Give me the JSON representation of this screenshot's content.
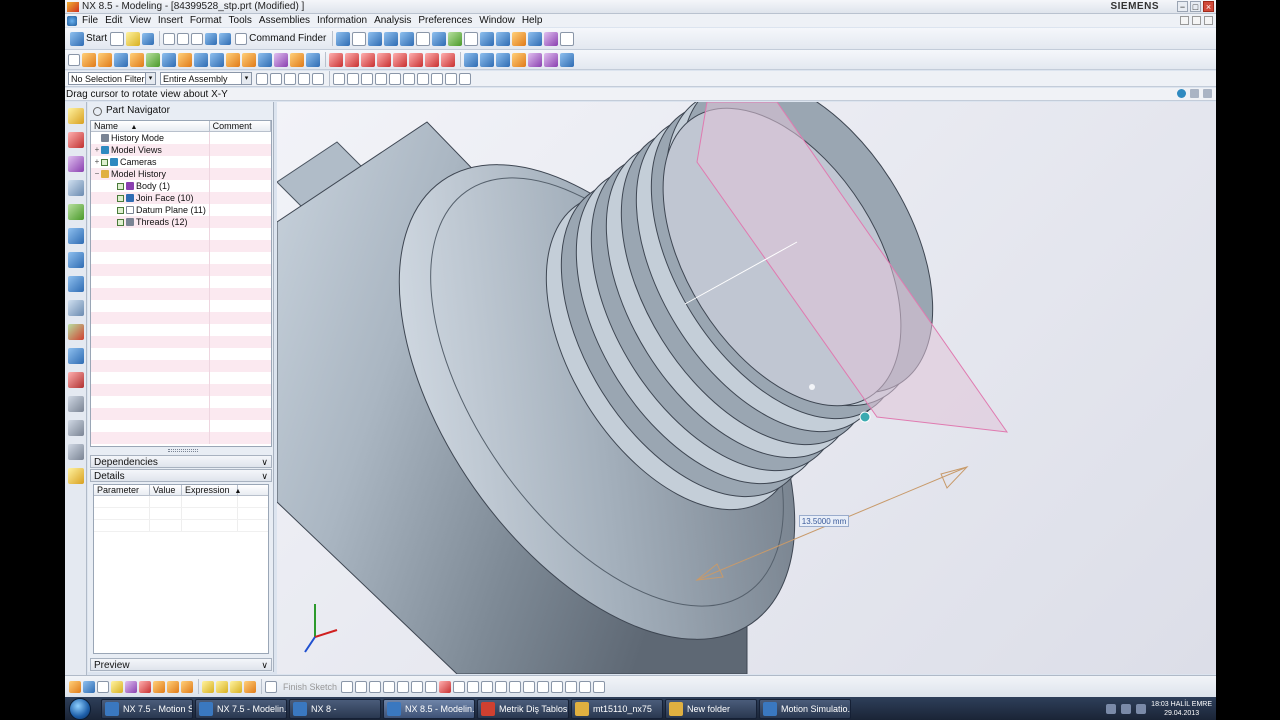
{
  "window": {
    "title": "NX 8.5 - Modeling - [84399528_stp.prt (Modified) ]",
    "brand": "SIEMENS",
    "minimize": "−",
    "restore": "□",
    "close": "×"
  },
  "menu": [
    "File",
    "Edit",
    "View",
    "Insert",
    "Format",
    "Tools",
    "Assemblies",
    "Information",
    "Analysis",
    "Preferences",
    "Window",
    "Help"
  ],
  "toolbar": {
    "start_label": "Start",
    "command_finder_label": "Command Finder",
    "selection_filter": "No Selection Filter",
    "assembly_scope": "Entire Assembly",
    "select_arrow": "▾"
  },
  "cue_line": "Drag cursor to rotate view about X-Y",
  "part_navigator": {
    "title": "Part Navigator",
    "columns": [
      "Name",
      "Comment"
    ],
    "sort_indicator": "▲",
    "items": [
      {
        "label": "History Mode",
        "expander": "",
        "checked": false,
        "icon": "clock"
      },
      {
        "label": "Model Views",
        "expander": "+",
        "checked": false,
        "icon": "views"
      },
      {
        "label": "Cameras",
        "expander": "+",
        "checked": true,
        "icon": "camera"
      },
      {
        "label": "Model History",
        "expander": "−",
        "checked": false,
        "icon": "folder"
      },
      {
        "label": "Body (1)",
        "expander": "",
        "checked": true,
        "icon": "body",
        "indent": 2
      },
      {
        "label": "Join Face (10)",
        "expander": "",
        "checked": true,
        "icon": "face",
        "indent": 2
      },
      {
        "label": "Datum Plane (11)",
        "expander": "",
        "checked": true,
        "icon": "plane",
        "indent": 2
      },
      {
        "label": "Threads (12)",
        "expander": "",
        "checked": true,
        "icon": "thread",
        "indent": 2
      }
    ]
  },
  "panels": {
    "dependencies": "Dependencies",
    "details": "Details",
    "preview": "Preview",
    "chevron": "∨"
  },
  "details_columns": [
    "Parameter",
    "Value",
    "Expression"
  ],
  "graphics": {
    "dimension_label": "13.5000 mm"
  },
  "bottom_toolbar": {
    "finish_sketch": "Finish Sketch"
  },
  "taskbar": {
    "items": [
      {
        "label": "NX 7.5 - Motion S...",
        "color": "#3a78c0"
      },
      {
        "label": "NX 7.5 - Modelin...",
        "color": "#3a78c0"
      },
      {
        "label": "NX 8 -",
        "color": "#3a78c0"
      },
      {
        "label": "NX 8.5 - Modelin...",
        "color": "#3a78c0",
        "active": true
      },
      {
        "label": "Metrik Diş Tablos...",
        "color": "#d04030"
      },
      {
        "label": "mt15110_nx75",
        "color": "#e0b040"
      },
      {
        "label": "New folder",
        "color": "#e0b040"
      },
      {
        "label": "Motion Simulatio...",
        "color": "#3a78c0"
      }
    ],
    "clock_time": "18:03 HALİL EMRE",
    "clock_date": "29.04.2013"
  },
  "colors": {
    "accent": "#2f6cb3",
    "row_alt": "#fbe9f0",
    "datum_plane": "#e07ab0"
  }
}
